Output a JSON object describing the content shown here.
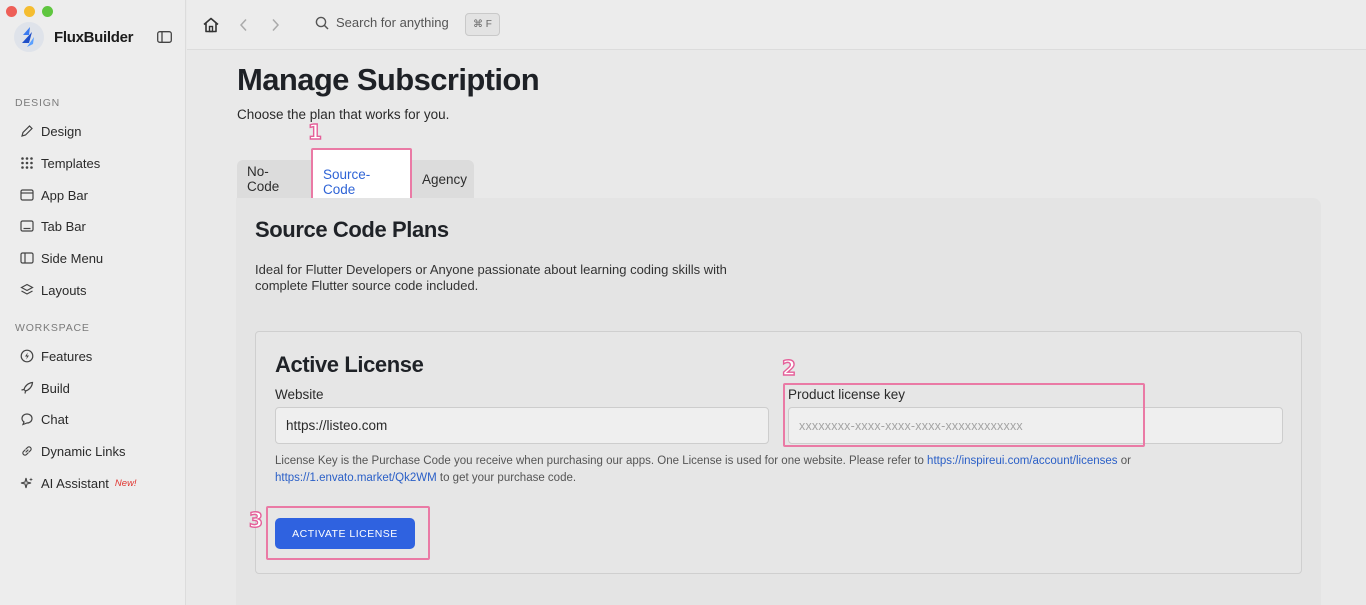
{
  "app": {
    "name": "FluxBuilder"
  },
  "colors": {
    "accent": "#2f62e0",
    "highlight": "#ea7aa5",
    "new_badge": "#e0342f"
  },
  "sidebar": {
    "sections": [
      {
        "label": "DESIGN"
      },
      {
        "label": "WORKSPACE"
      }
    ],
    "items": [
      {
        "label": "Design",
        "icon": "pen-icon"
      },
      {
        "label": "Templates",
        "icon": "grid-icon"
      },
      {
        "label": "App Bar",
        "icon": "app-bar-icon"
      },
      {
        "label": "Tab Bar",
        "icon": "tab-bar-icon"
      },
      {
        "label": "Side Menu",
        "icon": "side-menu-icon"
      },
      {
        "label": "Layouts",
        "icon": "layers-icon"
      },
      {
        "label": "Features",
        "icon": "bolt-icon"
      },
      {
        "label": "Build",
        "icon": "rocket-icon"
      },
      {
        "label": "Chat",
        "icon": "chat-icon"
      },
      {
        "label": "Dynamic Links",
        "icon": "link-icon"
      },
      {
        "label": "AI Assistant",
        "icon": "sparkle-icon",
        "badge": "New!"
      }
    ]
  },
  "topbar": {
    "search_placeholder": "Search for anything",
    "shortcut": "⌘ F"
  },
  "main": {
    "title": "Manage Subscription",
    "subtitle": "Choose the plan that works for you.",
    "tabs": [
      {
        "label": "No-Code"
      },
      {
        "label": "Source-Code",
        "active": true
      },
      {
        "label": "Agency"
      }
    ],
    "panel": {
      "title": "Source Code Plans",
      "description": "Ideal for Flutter Developers or Anyone passionate about learning coding skills with complete Flutter source code included."
    },
    "license": {
      "title": "Active License",
      "website_label": "Website",
      "website_value": "https://listeo.com",
      "key_label": "Product license key",
      "key_placeholder": "xxxxxxxx-xxxx-xxxx-xxxx-xxxxxxxxxxxx",
      "help_text_1": "License Key is the Purchase Code you receive when purchasing our apps. One License is used for one website. Please refer to ",
      "help_link_1": "https://inspireui.com/account/licenses",
      "help_text_2": " or ",
      "help_link_2": "https://1.envato.market/Qk2WM",
      "help_text_3": " to get your purchase code.",
      "activate_label": "ACTIVATE LICENSE"
    }
  },
  "annotations": [
    {
      "number": "1"
    },
    {
      "number": "2"
    },
    {
      "number": "3"
    }
  ]
}
